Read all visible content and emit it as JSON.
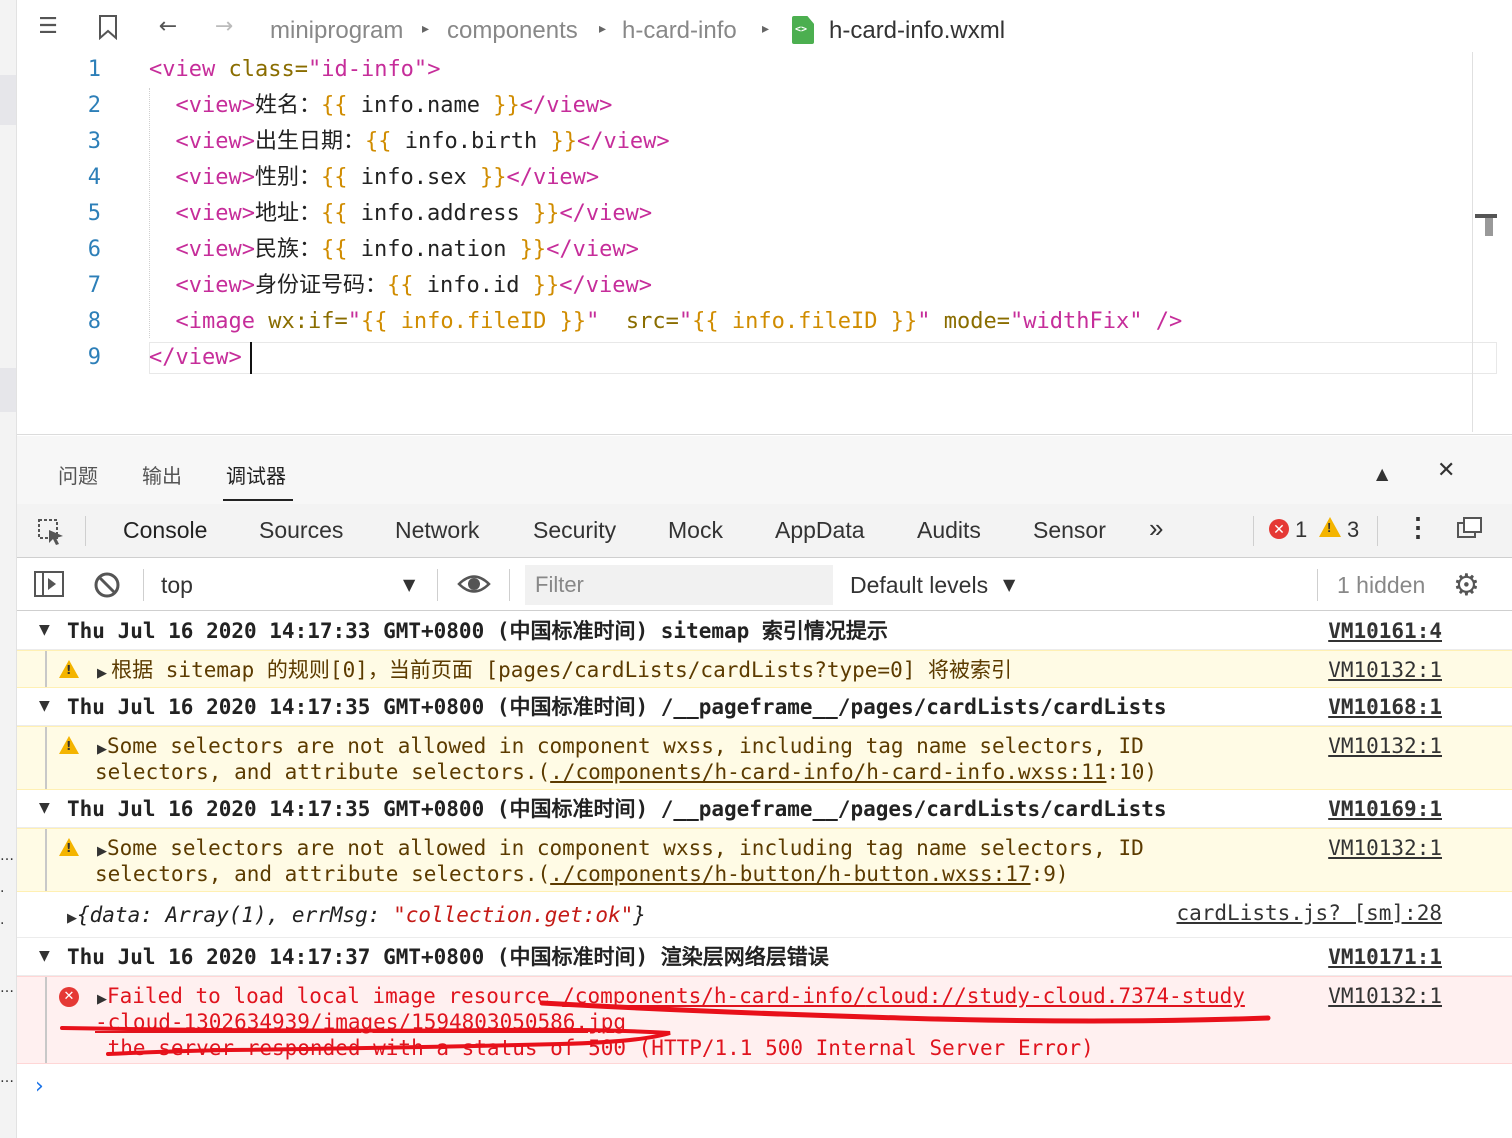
{
  "breadcrumb": {
    "segments": [
      "miniprogram",
      "components",
      "h-card-info"
    ],
    "file": "h-card-info.wxml"
  },
  "editor": {
    "line_numbers": [
      "1",
      "2",
      "3",
      "4",
      "5",
      "6",
      "7",
      "8",
      "9"
    ],
    "lines": [
      {
        "parts": [
          [
            "t",
            "<view "
          ],
          [
            "a",
            "class="
          ],
          [
            "s",
            "\"id-info\""
          ],
          [
            "t",
            ">"
          ]
        ]
      },
      {
        "parts": [
          [
            "p",
            "  "
          ],
          [
            "t",
            "<view>"
          ],
          [
            "p",
            "姓名："
          ],
          [
            "m",
            "{{"
          ],
          [
            "p",
            " info.name "
          ],
          [
            "m",
            "}}"
          ],
          [
            "t",
            "</view>"
          ]
        ]
      },
      {
        "parts": [
          [
            "p",
            "  "
          ],
          [
            "t",
            "<view>"
          ],
          [
            "p",
            "出生日期："
          ],
          [
            "m",
            "{{"
          ],
          [
            "p",
            " info.birth "
          ],
          [
            "m",
            "}}"
          ],
          [
            "t",
            "</view>"
          ]
        ]
      },
      {
        "parts": [
          [
            "p",
            "  "
          ],
          [
            "t",
            "<view>"
          ],
          [
            "p",
            "性别："
          ],
          [
            "m",
            "{{"
          ],
          [
            "p",
            " info.sex "
          ],
          [
            "m",
            "}}"
          ],
          [
            "t",
            "</view>"
          ]
        ]
      },
      {
        "parts": [
          [
            "p",
            "  "
          ],
          [
            "t",
            "<view>"
          ],
          [
            "p",
            "地址："
          ],
          [
            "m",
            "{{"
          ],
          [
            "p",
            " info.address "
          ],
          [
            "m",
            "}}"
          ],
          [
            "t",
            "</view>"
          ]
        ]
      },
      {
        "parts": [
          [
            "p",
            "  "
          ],
          [
            "t",
            "<view>"
          ],
          [
            "p",
            "民族："
          ],
          [
            "m",
            "{{"
          ],
          [
            "p",
            " info.nation "
          ],
          [
            "m",
            "}}"
          ],
          [
            "t",
            "</view>"
          ]
        ]
      },
      {
        "parts": [
          [
            "p",
            "  "
          ],
          [
            "t",
            "<view>"
          ],
          [
            "p",
            "身份证号码："
          ],
          [
            "m",
            "{{"
          ],
          [
            "p",
            " info.id "
          ],
          [
            "m",
            "}}"
          ],
          [
            "t",
            "</view>"
          ]
        ]
      },
      {
        "parts": [
          [
            "p",
            "  "
          ],
          [
            "t",
            "<image "
          ],
          [
            "a",
            "wx:if="
          ],
          [
            "s",
            "\""
          ],
          [
            "m",
            "{{ info.fileID }}"
          ],
          [
            "s",
            "\""
          ],
          [
            "p",
            "  "
          ],
          [
            "a",
            "src="
          ],
          [
            "s",
            "\""
          ],
          [
            "m",
            "{{ info.fileID }}"
          ],
          [
            "s",
            "\""
          ],
          [
            "p",
            " "
          ],
          [
            "a",
            "mode="
          ],
          [
            "s",
            "\"widthFix\""
          ],
          [
            "p",
            " "
          ],
          [
            "t",
            "/>"
          ]
        ]
      },
      {
        "parts": [
          [
            "t",
            "</view>"
          ]
        ]
      }
    ]
  },
  "panel_tabs": {
    "tabs": [
      "问题",
      "输出",
      "调试器"
    ],
    "active": "调试器"
  },
  "devtools_tabs": {
    "tabs": [
      "Console",
      "Sources",
      "Network",
      "Security",
      "Mock",
      "AppData",
      "Audits",
      "Sensor"
    ],
    "more": "»",
    "error_count": "1",
    "warning_count": "3"
  },
  "toolbar": {
    "context": "top",
    "filter_placeholder": "Filter",
    "levels": "Default levels",
    "hidden": "1 hidden"
  },
  "console": {
    "group1": {
      "text": "Thu Jul 16 2020 14:17:33 GMT+0800 (中国标准时间) sitemap 索引情况提示",
      "ref": "VM10161:4"
    },
    "warn1": {
      "text": "根据 sitemap 的规则[0]，当前页面 [pages/cardLists/cardLists?type=0] 将被索引",
      "ref": "VM10132:1"
    },
    "group2": {
      "text": "Thu Jul 16 2020 14:17:35 GMT+0800 (中国标准时间) /__pageframe__/pages/cardLists/cardLists",
      "ref": "VM10168:1"
    },
    "warn2": {
      "line1": "Some selectors are not allowed in component wxss, including tag name selectors, ID",
      "line2_prefix": "selectors, and attribute selectors.(",
      "line2_link": "./components/h-card-info/h-card-info.wxss:11",
      "line2_suffix": ":10)",
      "ref": "VM10132:1"
    },
    "group3": {
      "text": "Thu Jul 16 2020 14:17:35 GMT+0800 (中国标准时间) /__pageframe__/pages/cardLists/cardLists",
      "ref": "VM10169:1"
    },
    "warn3": {
      "line1": "Some selectors are not allowed in component wxss, including tag name selectors, ID",
      "line2_prefix": "selectors, and attribute selectors.(",
      "line2_link": "./components/h-button/h-button.wxss:17",
      "line2_suffix": ":9)",
      "ref": "VM10132:1"
    },
    "log": {
      "open": "{data: Array(1), errMsg: ",
      "str": "\"collection.get:ok\"",
      "close": "}",
      "ref": "cardLists.js? [sm]:28"
    },
    "group4": {
      "text": "Thu Jul 16 2020 14:17:37 GMT+0800 (中国标准时间) 渲染层网络层错误",
      "ref": "VM10171:1"
    },
    "error": {
      "line1_prefix": "Failed to load local image resource ",
      "line1_link1": "/components/h-card-info/",
      "line1_link2": "cloud://study-cloud.7374-study",
      "line2": "-cloud-1302634939/images/1594803050586.jpg",
      "line3": " the server responded with a status of 500 (HTTP/1.1 500 Internal Server Error)",
      "ref": "VM10132:1"
    }
  },
  "colors": {
    "tag": "#c62d9a",
    "attr": "#8a6d00",
    "mustache": "#d08c00",
    "line_number": "#2d7fb8",
    "accent": "#1a73e8",
    "error": "#e0141e",
    "warning_bg": "#fffbe5",
    "error_bg": "#fff0f0",
    "scribble": "#e8101a"
  }
}
